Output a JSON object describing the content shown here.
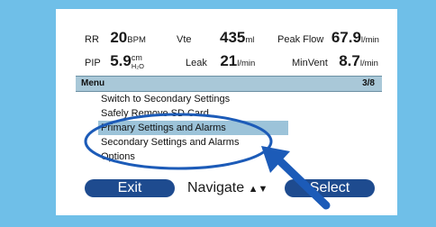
{
  "readouts": {
    "row1": [
      {
        "label": "RR",
        "value": "20",
        "unit": "BPM"
      },
      {
        "label": "Vte",
        "value": "435",
        "unit": "ml"
      },
      {
        "label": "Peak Flow",
        "value": "67.9",
        "unit": "l/min"
      }
    ],
    "row2": [
      {
        "label": "PIP",
        "value": "5.9",
        "unit_top": "cm",
        "unit_sub": "H₂O"
      },
      {
        "label": "Leak",
        "value": "21",
        "unit": "l/min"
      },
      {
        "label": "MinVent",
        "value": "8.7",
        "unit": "l/min"
      }
    ]
  },
  "menu": {
    "title": "Menu",
    "page": "3/8",
    "items": [
      "Switch to Secondary Settings",
      "Safely Remove SD Card",
      "Primary Settings and Alarms",
      "Secondary Settings and Alarms",
      "Options"
    ],
    "selected_index": 2
  },
  "buttons": {
    "exit": "Exit",
    "navigate": "Navigate",
    "navigate_arrows": "▲▼",
    "select": "Select"
  },
  "colors": {
    "background": "#6fbfe8",
    "button": "#1e4b8f",
    "selection": "#9cc3d9",
    "annotation": "#1c5bb8"
  }
}
